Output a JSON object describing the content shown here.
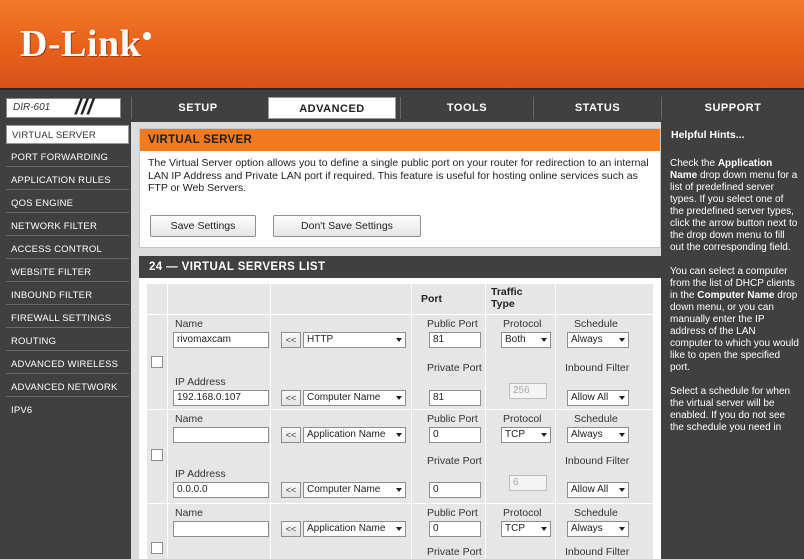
{
  "brand": {
    "logo": "D-Link"
  },
  "model": {
    "name": "DIR-601",
    "slashes": "///"
  },
  "tabs": [
    {
      "label": "SETUP"
    },
    {
      "label": "ADVANCED"
    },
    {
      "label": "TOOLS"
    },
    {
      "label": "STATUS"
    },
    {
      "label": "SUPPORT"
    }
  ],
  "sidebar": {
    "items": [
      {
        "label": "VIRTUAL SERVER"
      },
      {
        "label": "PORT FORWARDING"
      },
      {
        "label": "APPLICATION RULES"
      },
      {
        "label": "QOS ENGINE"
      },
      {
        "label": "NETWORK FILTER"
      },
      {
        "label": "ACCESS CONTROL"
      },
      {
        "label": "WEBSITE FILTER"
      },
      {
        "label": "INBOUND FILTER"
      },
      {
        "label": "FIREWALL SETTINGS"
      },
      {
        "label": "ROUTING"
      },
      {
        "label": "ADVANCED WIRELESS"
      },
      {
        "label": "ADVANCED NETWORK"
      },
      {
        "label": "IPV6"
      }
    ]
  },
  "virtual_server": {
    "title": "VIRTUAL SERVER",
    "description": "The Virtual Server option allows you to define a single public port on your router for redirection to an internal LAN IP Address and Private LAN port if required. This feature is useful for hosting online services such as FTP or Web Servers.",
    "save_label": "Save Settings",
    "dont_save_label": "Don't Save Settings"
  },
  "list": {
    "title": "24 — VIRTUAL SERVERS LIST",
    "headers": {
      "port": "Port",
      "traffic": "Traffic",
      "type": "Type"
    },
    "labels": {
      "name": "Name",
      "ip_address": "IP Address",
      "public_port": "Public Port",
      "private_port": "Private Port",
      "protocol": "Protocol",
      "schedule": "Schedule",
      "inbound_filter": "Inbound Filter",
      "ll": "<<"
    },
    "rows": [
      {
        "name": "rivomaxcam",
        "app": "HTTP",
        "ip": "192.168.0.107",
        "computer": "Computer Name",
        "public_port": "81",
        "private_port": "81",
        "protocol": "Both",
        "protocol_num": "256",
        "schedule": "Always",
        "inbound": "Allow All"
      },
      {
        "name": "",
        "app": "Application Name",
        "ip": "0.0.0.0",
        "computer": "Computer Name",
        "public_port": "0",
        "private_port": "0",
        "protocol": "TCP",
        "protocol_num": "6",
        "schedule": "Always",
        "inbound": "Allow All"
      },
      {
        "name": "",
        "app": "Application Name",
        "public_port": "0",
        "protocol": "TCP",
        "schedule": "Always"
      }
    ]
  },
  "hints": {
    "title": "Helpful Hints...",
    "p1_a": "Check the ",
    "p1_b": "Application Name",
    "p1_c": " drop down menu for a list of predefined server types. If you select one of the predefined server types, click the arrow button next to the drop down menu to fill out the corresponding field.",
    "p2_a": "You can select a computer from the list of DHCP clients in the ",
    "p2_b": "Computer Name",
    "p2_c": " drop down menu, or you can manually enter the IP address of the LAN computer to which you would like to open the specified port.",
    "p3": "Select a schedule for when the virtual server will be enabled. If you do not see the schedule you need in"
  }
}
